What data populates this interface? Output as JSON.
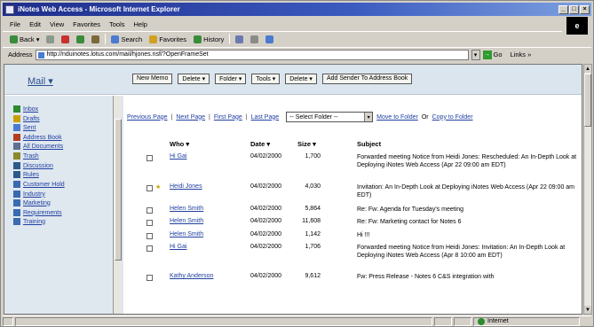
{
  "window": {
    "title": "iNotes Web Access - Microsoft Internet Explorer"
  },
  "menu": [
    "File",
    "Edit",
    "View",
    "Favorites",
    "Tools",
    "Help"
  ],
  "toolbar": {
    "back": "Back",
    "search": "Search",
    "favorites": "Favorites",
    "history": "History"
  },
  "address": {
    "label": "Address",
    "url": "http://nduinotes.lotus.com/mail/hjones.nsf/?OpenFrameSet",
    "go": "Go",
    "links": "Links"
  },
  "mail": {
    "title": "Mail",
    "actions": [
      "New Memo",
      "Delete",
      "Folder",
      "Tools",
      "Delete",
      "Add Sender To Address Book"
    ]
  },
  "sidebar": {
    "items": [
      {
        "label": "Inbox",
        "icon": "inbox-icon",
        "color": "#2d8a2d"
      },
      {
        "label": "Drafts",
        "icon": "drafts-icon",
        "color": "#c8a000"
      },
      {
        "label": "Sent",
        "icon": "sent-icon",
        "color": "#4a7bd0"
      },
      {
        "label": "Address Book",
        "icon": "address-book-icon",
        "color": "#b04020"
      },
      {
        "label": "All Documents",
        "icon": "all-documents-icon",
        "color": "#607090"
      },
      {
        "label": "Trash",
        "icon": "trash-icon",
        "color": "#8a8a2a"
      },
      {
        "label": "Discussion",
        "icon": "discussion-icon",
        "color": "#2d5a8a"
      },
      {
        "label": "Rules",
        "icon": "rules-icon",
        "color": "#2d5a8a"
      },
      {
        "label": "Customer Hold",
        "icon": "folder-icon",
        "color": "#3a6ab0"
      },
      {
        "label": "Industry",
        "icon": "folder-icon",
        "color": "#3a6ab0"
      },
      {
        "label": "Marketing",
        "icon": "folder-icon",
        "color": "#3a6ab0"
      },
      {
        "label": "Requirements",
        "icon": "folder-icon",
        "color": "#3a6ab0"
      },
      {
        "label": "Training",
        "icon": "folder-icon",
        "color": "#3a6ab0"
      }
    ]
  },
  "nav": {
    "previous": "Previous Page",
    "next": "Next Page",
    "first": "First Page",
    "last": "Last Page",
    "folder_select": "-- Select Folder --",
    "move": "Move to Folder",
    "or": "Or",
    "copy": "Copy to Folder"
  },
  "columns": {
    "who": "Who",
    "date": "Date",
    "size": "Size",
    "subject": "Subject"
  },
  "messages": [
    {
      "who": "Hi Gai",
      "date": "04/02/2000",
      "size": "1,700",
      "subject": "Forwarded meeting Notice from Heidi Jones: Rescheduled: An In-Depth Look at Deploying iNotes Web Access (Apr 22 09:00 am EDT)",
      "flag": ""
    },
    {
      "who": "Heidi Jones",
      "date": "04/02/2000",
      "size": "4,030",
      "subject": "Invitation: An In-Depth Look at Deploying iNotes Web Access (Apr 22 09:00 am EDT)",
      "flag": "★"
    },
    {
      "who": "Helen Smith",
      "date": "04/02/2000",
      "size": "5,864",
      "subject": "Re: Fw: Agenda for Tuesday's meeting",
      "flag": ""
    },
    {
      "who": "Helen Smith",
      "date": "04/02/2000",
      "size": "11,608",
      "subject": "Re: Fw: Marketing contact for Notes 6",
      "flag": ""
    },
    {
      "who": "Helen Smith",
      "date": "04/02/2000",
      "size": "1,142",
      "subject": "Hi !!!",
      "flag": ""
    },
    {
      "who": "Hi Gai",
      "date": "04/02/2000",
      "size": "1,706",
      "subject": "Forwarded meeting Notice from Heidi Jones: Invitation: An In-Depth Look at Deploying iNotes Web Access (Apr 8 10:00 am EDT)",
      "flag": ""
    },
    {
      "who": "Kathy Anderson",
      "date": "04/02/2000",
      "size": "9,612",
      "subject": "Fw: Press Release - Notes 6 C&S integration with",
      "flag": ""
    }
  ],
  "status": {
    "zone": "Internet"
  }
}
